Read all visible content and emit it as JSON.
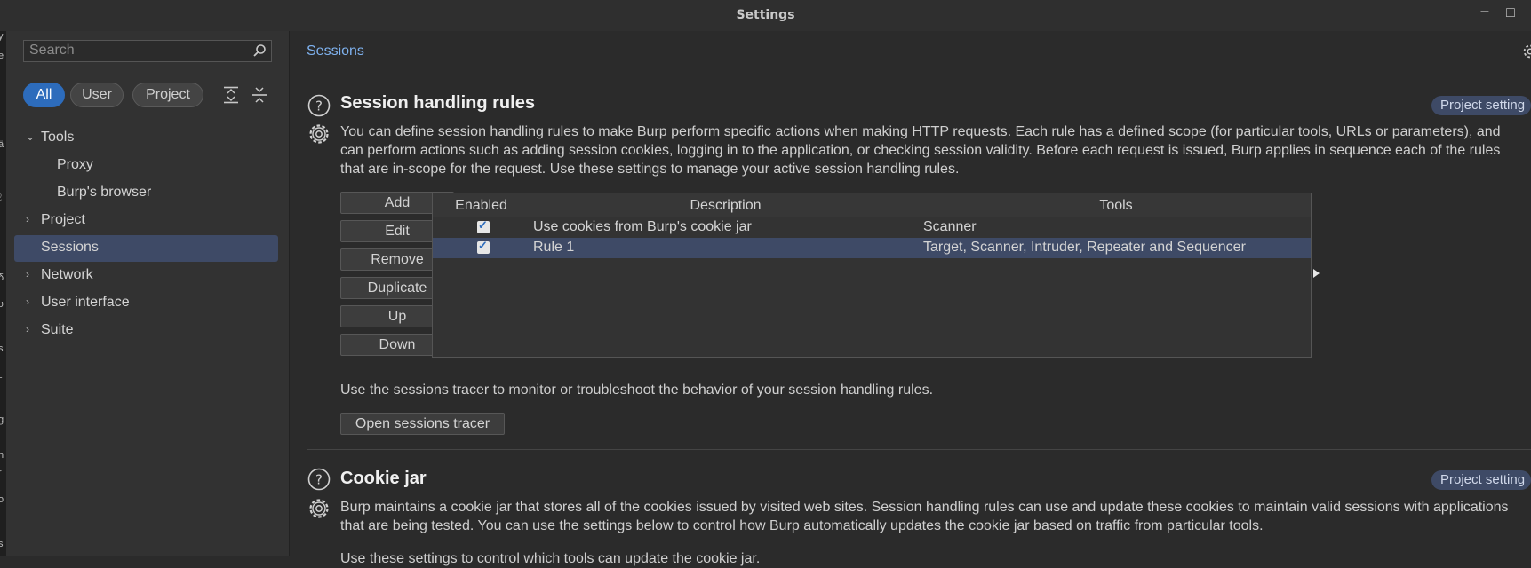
{
  "window": {
    "title": "Settings"
  },
  "sidebar": {
    "search_placeholder": "Search",
    "filters": [
      "All",
      "User",
      "Project"
    ],
    "tree": [
      {
        "label": "Tools",
        "expanded": true
      },
      {
        "label": "Proxy"
      },
      {
        "label": "Burp's browser"
      },
      {
        "label": "Project",
        "expanded": false
      },
      {
        "label": "Sessions",
        "selected": true
      },
      {
        "label": "Network",
        "expanded": false
      },
      {
        "label": "User interface",
        "expanded": false
      },
      {
        "label": "Suite",
        "expanded": false
      }
    ]
  },
  "breadcrumb": "Sessions",
  "session_rules": {
    "title": "Session handling rules",
    "badge": "Project setting",
    "description": "You can define session handling rules to make Burp perform specific actions when making HTTP requests. Each rule has a defined scope (for particular tools, URLs or parameters), and can perform actions such as adding session cookies, logging in to the application, or checking session validity. Before each request is issued, Burp applies in sequence each of the rules that are in-scope for the request. Use these settings to manage your active session handling rules.",
    "buttons": [
      "Add",
      "Edit",
      "Remove",
      "Duplicate",
      "Up",
      "Down"
    ],
    "columns": [
      "Enabled",
      "Description",
      "Tools"
    ],
    "rows": [
      {
        "enabled": true,
        "description": "Use cookies from Burp's cookie jar",
        "tools": "Scanner"
      },
      {
        "enabled": true,
        "description": "Rule 1",
        "tools": "Target, Scanner, Intruder, Repeater and Sequencer"
      }
    ],
    "tracer_text": "Use the sessions tracer to monitor or troubleshoot the behavior of your session handling rules.",
    "tracer_button": "Open sessions tracer"
  },
  "cookie_jar": {
    "title": "Cookie jar",
    "badge": "Project setting",
    "description": "Burp maintains a cookie jar that stores all of the cookies issued by visited web sites. Session handling rules can use and update these cookies to maintain valid sessions with applications that are being tested. You can use the settings below to control how Burp automatically updates the cookie jar based on traffic from particular tools.",
    "partial_text": "Use these settings to control which tools can update the cookie jar."
  },
  "colors": {
    "accent": "#2d6cbc",
    "selection": "#3e4a66",
    "link": "#7fb2ef"
  }
}
